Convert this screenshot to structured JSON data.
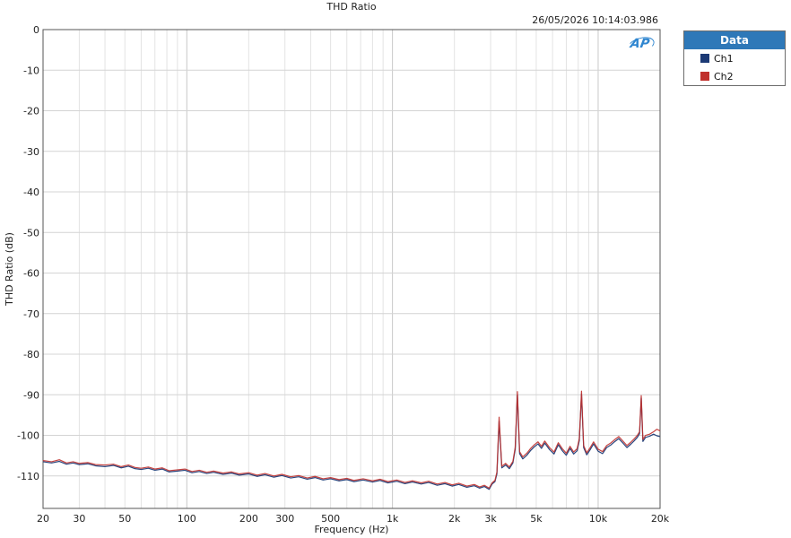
{
  "window": {
    "title": "THD Ratio",
    "timestamp": "26/05/2026 10:14:03.986"
  },
  "legend": {
    "header": "Data",
    "items": [
      {
        "label": "Ch1",
        "color": "#1c3a75"
      },
      {
        "label": "Ch2",
        "color": "#c0302c"
      }
    ]
  },
  "logo": {
    "text": "AP"
  },
  "chart_data": {
    "type": "line",
    "title": "THD Ratio",
    "xlabel": "Frequency (Hz)",
    "ylabel": "THD Ratio (dB)",
    "xscale": "log",
    "xlim": [
      20,
      20000
    ],
    "ylim": [
      -118,
      0
    ],
    "grid": true,
    "legend_position": "outside-right",
    "x_ticks": [
      20,
      30,
      50,
      100,
      200,
      300,
      500,
      1000,
      2000,
      3000,
      5000,
      10000,
      20000
    ],
    "x_tick_labels": [
      "20",
      "30",
      "50",
      "100",
      "200",
      "300",
      "500",
      "1k",
      "2k",
      "3k",
      "5k",
      "10k",
      "20k"
    ],
    "y_ticks": [
      0,
      -10,
      -20,
      -30,
      -40,
      -50,
      -60,
      -70,
      -80,
      -90,
      -100,
      -110
    ],
    "y_tick_labels": [
      "0",
      "-10",
      "-20",
      "-30",
      "-40",
      "-50",
      "-60",
      "-70",
      "-80",
      "-90",
      "-100",
      "-110"
    ],
    "series": [
      {
        "name": "Ch1",
        "color": "#1c3a75",
        "x": [
          20,
          22,
          24,
          26,
          28,
          30,
          33,
          36,
          40,
          44,
          48,
          52,
          56,
          60,
          65,
          70,
          76,
          82,
          90,
          98,
          106,
          115,
          125,
          135,
          150,
          165,
          180,
          200,
          220,
          240,
          265,
          290,
          320,
          350,
          385,
          420,
          460,
          500,
          550,
          600,
          650,
          720,
          800,
          870,
          950,
          1050,
          1150,
          1250,
          1380,
          1500,
          1650,
          1800,
          1950,
          2100,
          2300,
          2500,
          2650,
          2800,
          2950,
          3050,
          3150,
          3220,
          3300,
          3400,
          3550,
          3700,
          3850,
          3950,
          4050,
          4150,
          4300,
          4500,
          4700,
          4900,
          5100,
          5300,
          5500,
          5800,
          6100,
          6400,
          6700,
          7000,
          7300,
          7600,
          7900,
          8100,
          8300,
          8500,
          8800,
          9100,
          9500,
          10000,
          10500,
          11000,
          11500,
          12000,
          12600,
          13200,
          13800,
          14400,
          15000,
          15500,
          15900,
          16200,
          16500,
          17000,
          17800,
          18600,
          19300,
          20000
        ],
        "y": [
          -106.5,
          -106.8,
          -106.4,
          -107.1,
          -106.8,
          -107.2,
          -107.0,
          -107.5,
          -107.7,
          -107.4,
          -108.0,
          -107.6,
          -108.2,
          -108.4,
          -108.1,
          -108.6,
          -108.3,
          -109.0,
          -108.8,
          -108.6,
          -109.2,
          -108.9,
          -109.4,
          -109.1,
          -109.6,
          -109.3,
          -109.8,
          -109.5,
          -110.1,
          -109.7,
          -110.3,
          -109.9,
          -110.5,
          -110.2,
          -110.8,
          -110.4,
          -111.0,
          -110.7,
          -111.2,
          -110.9,
          -111.4,
          -111.0,
          -111.5,
          -111.1,
          -111.7,
          -111.3,
          -111.9,
          -111.5,
          -112.0,
          -111.6,
          -112.3,
          -111.9,
          -112.5,
          -112.1,
          -112.8,
          -112.4,
          -113.0,
          -112.6,
          -113.3,
          -112.0,
          -111.4,
          -109.5,
          -96.5,
          -108.0,
          -107.3,
          -108.2,
          -106.8,
          -103.5,
          -90.0,
          -104.5,
          -105.8,
          -104.9,
          -103.7,
          -102.8,
          -102.1,
          -103.2,
          -101.9,
          -103.5,
          -104.6,
          -102.3,
          -103.8,
          -104.9,
          -103.2,
          -104.6,
          -103.8,
          -101.3,
          -89.8,
          -103.0,
          -104.8,
          -103.7,
          -102.1,
          -103.9,
          -104.5,
          -103.0,
          -102.4,
          -101.6,
          -100.8,
          -101.9,
          -103.0,
          -102.2,
          -101.3,
          -100.5,
          -99.6,
          -90.8,
          -101.5,
          -100.5,
          -100.2,
          -99.7,
          -100.1,
          -100.3
        ]
      },
      {
        "name": "Ch2",
        "color": "#c0302c",
        "x": [
          20,
          22,
          24,
          26,
          28,
          30,
          33,
          36,
          40,
          44,
          48,
          52,
          56,
          60,
          65,
          70,
          76,
          82,
          90,
          98,
          106,
          115,
          125,
          135,
          150,
          165,
          180,
          200,
          220,
          240,
          265,
          290,
          320,
          350,
          385,
          420,
          460,
          500,
          550,
          600,
          650,
          720,
          800,
          870,
          950,
          1050,
          1150,
          1250,
          1380,
          1500,
          1650,
          1800,
          1950,
          2100,
          2300,
          2500,
          2650,
          2800,
          2950,
          3050,
          3150,
          3220,
          3300,
          3400,
          3550,
          3700,
          3850,
          3950,
          4050,
          4150,
          4300,
          4500,
          4700,
          4900,
          5100,
          5300,
          5500,
          5800,
          6100,
          6400,
          6700,
          7000,
          7300,
          7600,
          7900,
          8100,
          8300,
          8500,
          8800,
          9100,
          9500,
          10000,
          10500,
          11000,
          11500,
          12000,
          12600,
          13200,
          13800,
          14400,
          15000,
          15500,
          15900,
          16200,
          16500,
          17000,
          17800,
          18600,
          19300,
          20000
        ],
        "y": [
          -106.2,
          -106.5,
          -106.0,
          -106.8,
          -106.5,
          -106.9,
          -106.7,
          -107.2,
          -107.3,
          -107.1,
          -107.7,
          -107.3,
          -107.9,
          -108.1,
          -107.8,
          -108.3,
          -108.0,
          -108.7,
          -108.5,
          -108.3,
          -108.9,
          -108.6,
          -109.1,
          -108.8,
          -109.3,
          -109.0,
          -109.5,
          -109.2,
          -109.8,
          -109.4,
          -110.0,
          -109.6,
          -110.2,
          -109.9,
          -110.5,
          -110.1,
          -110.7,
          -110.4,
          -110.9,
          -110.6,
          -111.1,
          -110.7,
          -111.2,
          -110.8,
          -111.4,
          -111.0,
          -111.6,
          -111.2,
          -111.7,
          -111.3,
          -112.0,
          -111.6,
          -112.2,
          -111.8,
          -112.5,
          -112.1,
          -112.7,
          -112.3,
          -113.0,
          -111.7,
          -111.1,
          -109.0,
          -95.5,
          -107.6,
          -106.9,
          -107.8,
          -106.4,
          -103.0,
          -89.2,
          -104.0,
          -105.3,
          -104.4,
          -103.2,
          -102.3,
          -101.6,
          -102.7,
          -101.4,
          -103.0,
          -104.1,
          -101.8,
          -103.3,
          -104.4,
          -102.7,
          -104.1,
          -103.3,
          -100.8,
          -89.1,
          -102.5,
          -104.3,
          -103.2,
          -101.6,
          -103.4,
          -104.0,
          -102.5,
          -101.9,
          -101.1,
          -100.3,
          -101.4,
          -102.5,
          -101.7,
          -100.8,
          -100.0,
          -99.1,
          -90.2,
          -101.0,
          -100.0,
          -99.7,
          -99.1,
          -98.5,
          -98.9
        ]
      }
    ]
  }
}
